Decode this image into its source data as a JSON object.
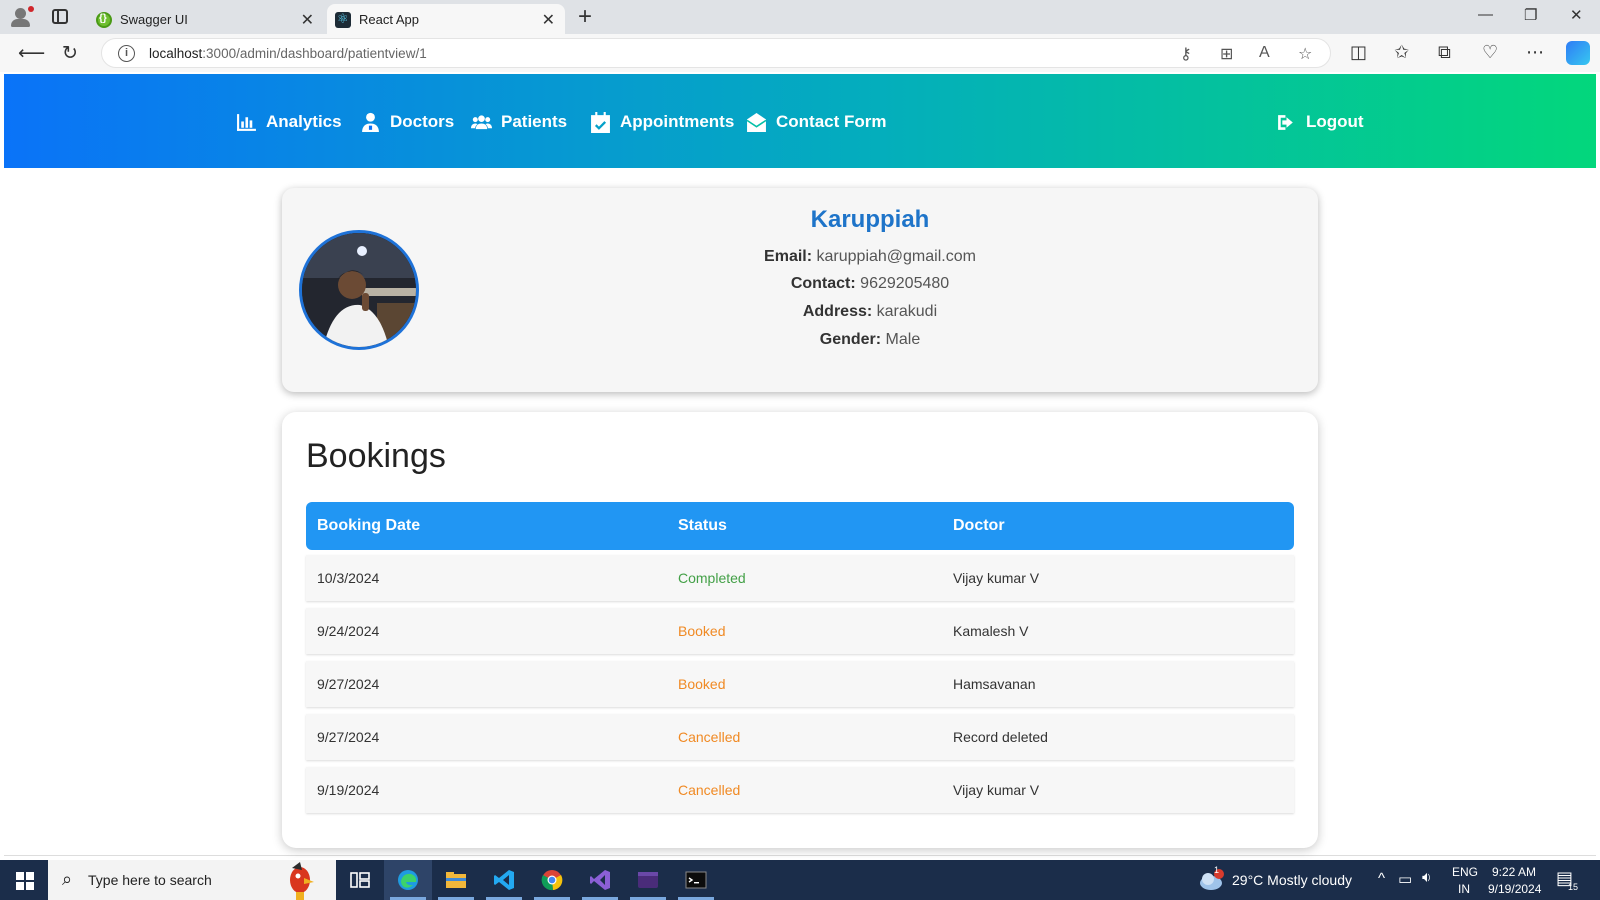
{
  "browser": {
    "tabs": [
      {
        "title": "Swagger UI",
        "active": false
      },
      {
        "title": "React App",
        "active": true
      }
    ],
    "url_host": "localhost",
    "url_path": ":3000/admin/dashboard/patientview/1"
  },
  "navbar": {
    "items": [
      {
        "label": "Analytics",
        "icon": "chart-bar-icon"
      },
      {
        "label": "Doctors",
        "icon": "user-doctor-icon"
      },
      {
        "label": "Patients",
        "icon": "users-icon"
      },
      {
        "label": "Appointments",
        "icon": "calendar-check-icon"
      },
      {
        "label": "Contact Form",
        "icon": "envelope-open-icon"
      }
    ],
    "logout_label": "Logout"
  },
  "patient": {
    "name": "Karuppiah",
    "email_label": "Email:",
    "email": "karuppiah@gmail.com",
    "contact_label": "Contact:",
    "contact": "9629205480",
    "address_label": "Address:",
    "address": "karakudi",
    "gender_label": "Gender:",
    "gender": "Male"
  },
  "bookings": {
    "title": "Bookings",
    "columns": [
      "Booking Date",
      "Status",
      "Doctor"
    ],
    "rows": [
      {
        "date": "10/3/2024",
        "status": "Completed",
        "doctor": "Vijay kumar V"
      },
      {
        "date": "9/24/2024",
        "status": "Booked",
        "doctor": "Kamalesh V"
      },
      {
        "date": "9/27/2024",
        "status": "Booked",
        "doctor": "Hamsavanan"
      },
      {
        "date": "9/27/2024",
        "status": "Cancelled",
        "doctor": "Record deleted"
      },
      {
        "date": "9/19/2024",
        "status": "Cancelled",
        "doctor": "Vijay kumar V"
      }
    ],
    "status_colors": {
      "Completed": "#43a047",
      "Booked": "#f08a24",
      "Cancelled": "#f08a24"
    }
  },
  "colors": {
    "navbar_gradient": [
      "#0a73f8",
      "#04aebc",
      "#03d77c"
    ],
    "name_color": "#1e74c9",
    "table_header": "#2196f3"
  },
  "taskbar": {
    "search_placeholder": "Type here to search",
    "weather": "29°C  Mostly cloudy",
    "weather_badge": "1",
    "lang_top": "ENG",
    "lang_bottom": "IN",
    "time": "9:22 AM",
    "date": "9/19/2024",
    "notification_count": "15"
  }
}
